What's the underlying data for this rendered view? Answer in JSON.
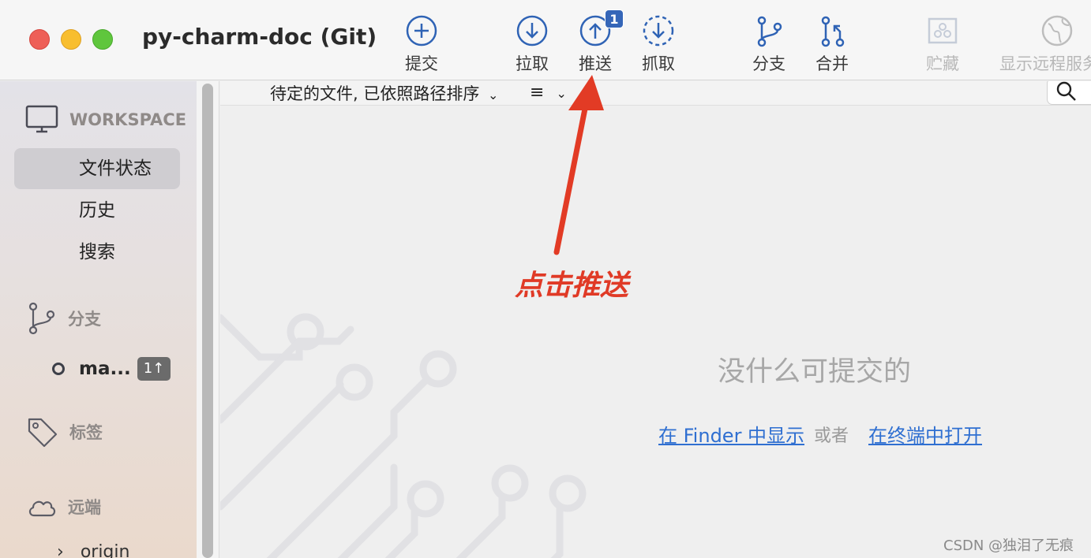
{
  "window": {
    "title": "py-charm-doc (Git)"
  },
  "toolbar": {
    "commit": "提交",
    "pull": "拉取",
    "push": "推送",
    "push_badge": "1",
    "fetch": "抓取",
    "branch": "分支",
    "merge": "合并",
    "stash": "贮藏",
    "show_remote": "显示远程服务"
  },
  "sidebar": {
    "workspace_header": "WORKSPACE",
    "items": [
      {
        "label": "文件状态",
        "selected": true
      },
      {
        "label": "历史"
      },
      {
        "label": "搜索"
      }
    ],
    "branches_header": "分支",
    "current_branch": "ma...",
    "branch_badge": "1↑",
    "tags_header": "标签",
    "remotes_header": "远端",
    "remote_item": "origin"
  },
  "main": {
    "sort_label": "待定的文件, 已依照路径排序",
    "list_icon": "≡",
    "empty_message": "没什么可提交的",
    "show_in_finder": "在 Finder 中显示",
    "or": "或者",
    "open_in_terminal": "在终端中打开"
  },
  "annotation": {
    "text": "点击推送",
    "color": "#e03a26"
  },
  "watermark": "CSDN @独泪了无痕",
  "colors": {
    "accent": "#3566b8",
    "link": "#2f6fd1"
  }
}
